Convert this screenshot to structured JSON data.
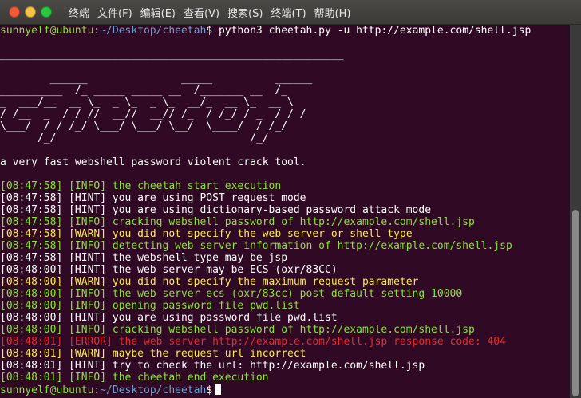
{
  "window": {
    "menu": [
      "终端",
      "文件(F)",
      "编辑(E)",
      "查看(V)",
      "搜索(S)",
      "终端(T)",
      "帮助(H)"
    ]
  },
  "prompt": {
    "user_host": "sunnyelf@ubuntu",
    "path": "~/Desktop/cheetah",
    "symbol": "$",
    "command": " python3 cheetah.py -u http://example.com/shell.jsp"
  },
  "banner": {
    "rule": "_______________________________________________________",
    "art": [
      "        ______               _____          ______",
      "__________  /_ _____ _____ __  /_______ __  /_",
      "_  ___/__  __ \\_  _ \\_  _ \\_  __/_  __ \\_  __ \\",
      "/ /__  _  / / //  __//  __// /_  / /_/ / _  / / /",
      "\\___/  / / /_/ \\___/ \\___/ \\__/  \\____/  / /_/",
      "      /_/                               /_/"
    ],
    "tagline": "a very fast webshell password violent crack tool."
  },
  "log": [
    {
      "level": "info",
      "text": "[08:47:58] [INFO] the cheetah start execution"
    },
    {
      "level": "hint",
      "text": "[08:47:58] [HINT] you are using POST request mode"
    },
    {
      "level": "hint",
      "text": "[08:47:58] [HINT] you are using dictionary-based password attack mode"
    },
    {
      "level": "info",
      "text": "[08:47:58] [INFO] cracking webshell password of http://example.com/shell.jsp"
    },
    {
      "level": "warn",
      "text": "[08:47:58] [WARN] you did not specify the web server or shell type"
    },
    {
      "level": "info",
      "text": "[08:47:58] [INFO] detecting web server information of http://example.com/shell.jsp"
    },
    {
      "level": "hint",
      "text": "[08:47:58] [HINT] the webshell type may be jsp"
    },
    {
      "level": "hint",
      "text": "[08:48:00] [HINT] the web server may be ECS (oxr/83CC)"
    },
    {
      "level": "warn",
      "text": "[08:48:00] [WARN] you did not specify the maximum request parameter"
    },
    {
      "level": "info",
      "text": "[08:48:00] [INFO] the web server ecs (oxr/83cc) post default setting 10000"
    },
    {
      "level": "info",
      "text": "[08:48:00] [INFO] opening password file pwd.list"
    },
    {
      "level": "hint",
      "text": "[08:48:00] [HINT] you are using password file pwd.list"
    },
    {
      "level": "info",
      "text": "[08:48:00] [INFO] cracking webshell password of http://example.com/shell.jsp"
    },
    {
      "level": "err",
      "text": "[08:48:01] [ERROR] the web server http://example.com/shell.jsp response code: 404"
    },
    {
      "level": "warn",
      "text": "[08:48:01] [WARN] maybe the request url incorrect"
    },
    {
      "level": "hint",
      "text": "[08:48:01] [HINT] try to check the url: http://example.com/shell.jsp"
    },
    {
      "level": "info",
      "text": "[08:48:01] [INFO] the cheetah end execution"
    }
  ],
  "colors": {
    "background": "#300a24",
    "info": "#8ae234",
    "hint": "#ffffff",
    "warn": "#fce94f",
    "error": "#ef2929",
    "path": "#729fcf"
  }
}
